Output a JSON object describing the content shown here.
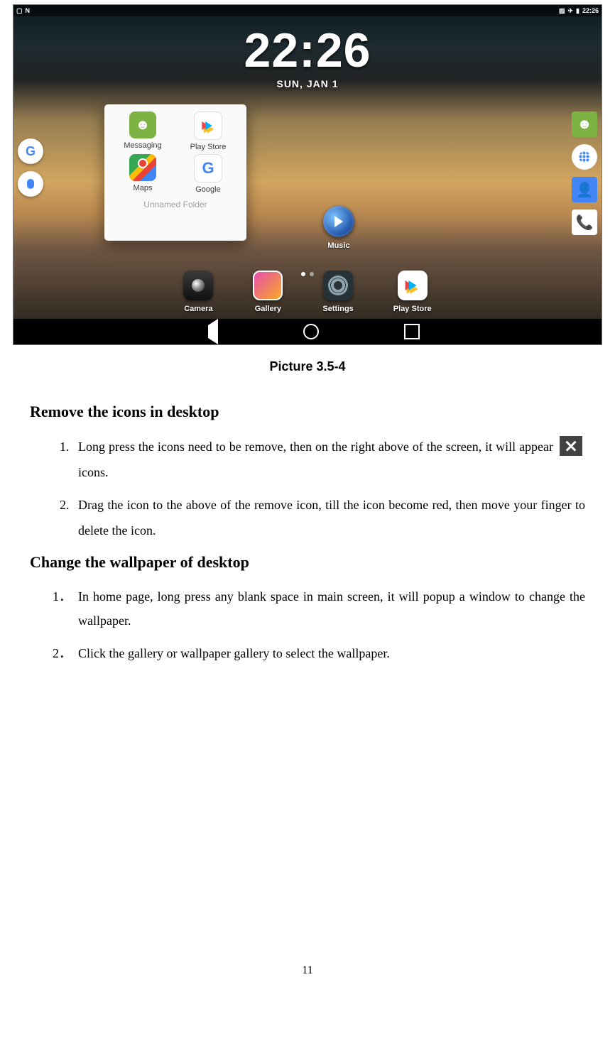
{
  "screenshot": {
    "status_bar": {
      "left_icons": [
        "image-icon",
        "n-icon"
      ],
      "right_icons": [
        "no-sim-icon",
        "airplane-icon",
        "battery-icon"
      ],
      "time": "22:26"
    },
    "clock": {
      "time": "22:26",
      "date": "SUN, JAN 1"
    },
    "folder": {
      "title": "Unnamed Folder",
      "apps": [
        {
          "name": "Messaging",
          "icon": "messaging-icon"
        },
        {
          "name": "Play Store",
          "icon": "play-store-icon"
        },
        {
          "name": "Maps",
          "icon": "maps-icon"
        },
        {
          "name": "Google",
          "icon": "google-icon"
        }
      ]
    },
    "left_edge": [
      {
        "name": "google-search-button",
        "label": "G"
      },
      {
        "name": "voice-search-button",
        "label": ""
      }
    ],
    "right_edge": [
      {
        "name": "messaging-shortcut"
      },
      {
        "name": "apps-drawer-button"
      },
      {
        "name": "contacts-shortcut"
      },
      {
        "name": "phone-shortcut"
      }
    ],
    "desktop_widgets": {
      "music": "Music"
    },
    "dock": [
      {
        "name": "Camera"
      },
      {
        "name": "Gallery"
      },
      {
        "name": "Settings"
      },
      {
        "name": "Play Store"
      }
    ],
    "nav": [
      "back",
      "home",
      "recent"
    ]
  },
  "caption": "Picture 3.5-4",
  "section1": {
    "heading": "Remove the icons in desktop",
    "item1_a": "Long press the icons need to be remove, then on the right above of the screen, it will appear ",
    "item1_b": " icons.",
    "item2": "Drag the icon to the above of the remove icon, till the icon become red, then move your finger to delete the icon."
  },
  "section2": {
    "heading": "Change the wallpaper of desktop",
    "item1": "In home page, long press any blank space in main screen, it will popup a window to change the wallpaper.",
    "item2": "Click the gallery or wallpaper gallery to select the wallpaper."
  },
  "page_number": "11"
}
